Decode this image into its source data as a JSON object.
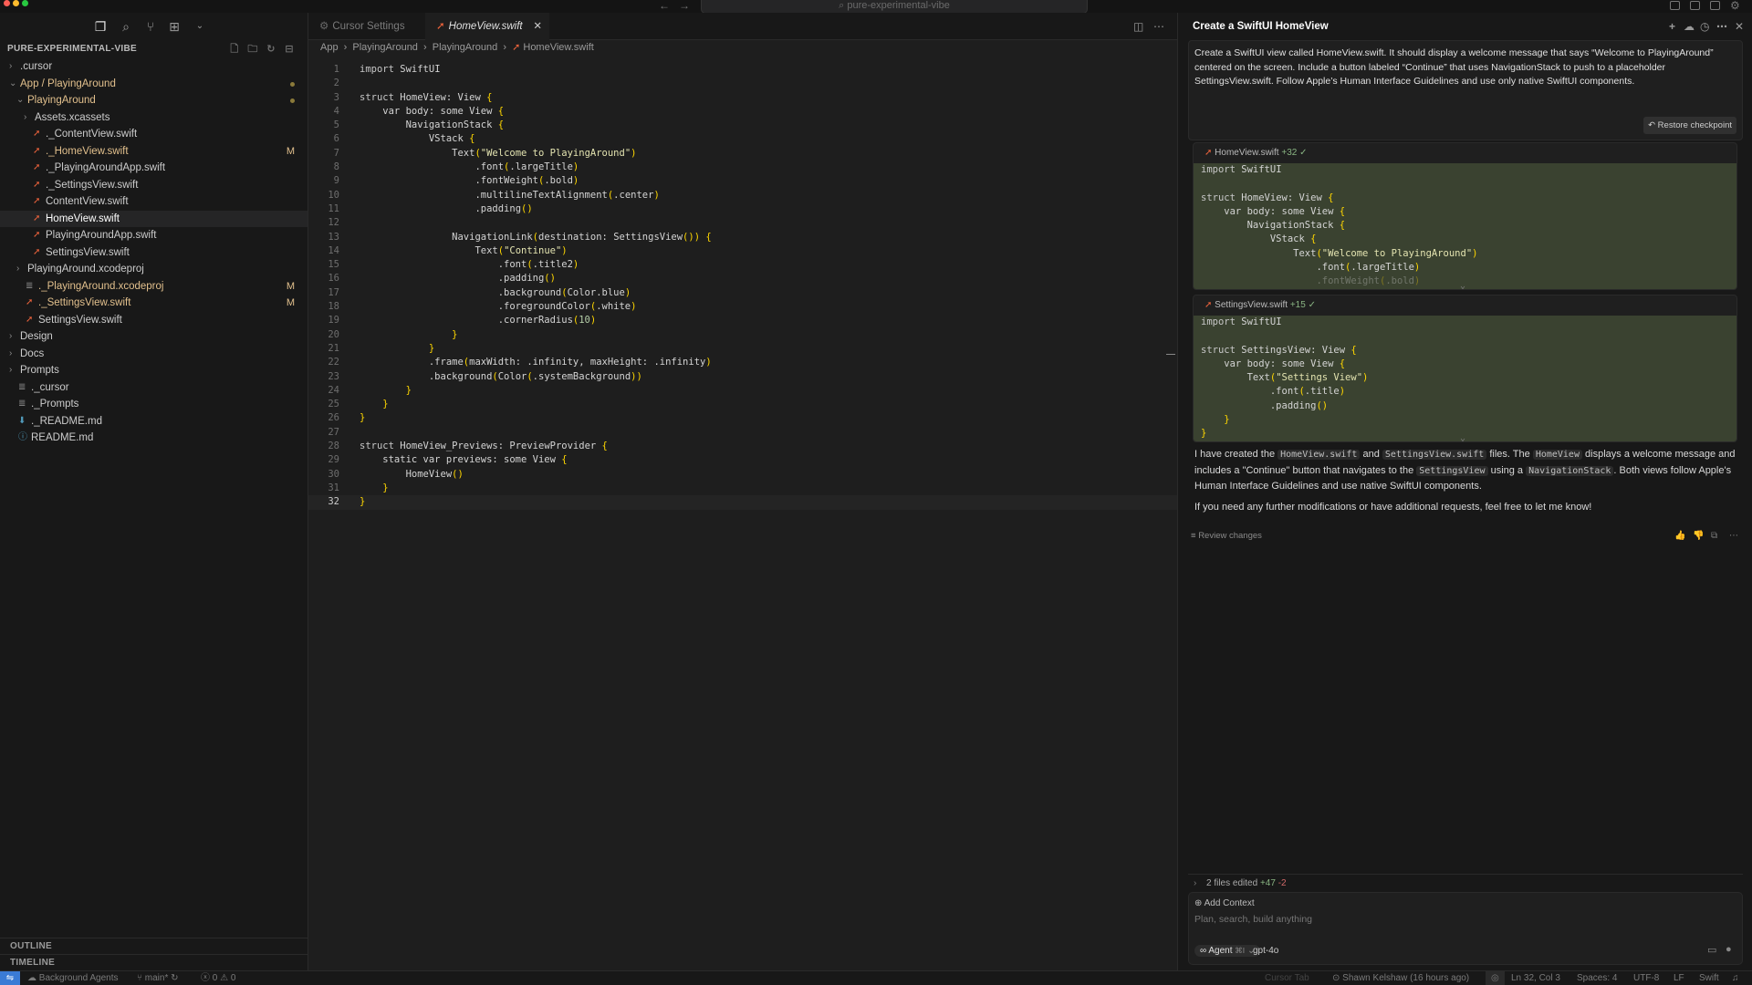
{
  "titlebar": {
    "search_text": "⌕ pure-experimental-vibe",
    "back_arrow": "←",
    "forward_arrow": "→"
  },
  "sidebar": {
    "section_title": "PURE-EXPERIMENTAL-VIBE",
    "tree": [
      {
        "label": ".cursor",
        "indent": 0,
        "kind": "folder",
        "expanded": false
      },
      {
        "label": "App / PlayingAround",
        "indent": 0,
        "kind": "folder",
        "expanded": true,
        "modified_dot": true,
        "color": "yellow"
      },
      {
        "label": "PlayingAround",
        "indent": 1,
        "kind": "folder",
        "expanded": true,
        "modified_dot": true,
        "color": "yellow"
      },
      {
        "label": "Assets.xcassets",
        "indent": 2,
        "kind": "folder",
        "expanded": false
      },
      {
        "label": "._ContentView.swift",
        "indent": 2,
        "kind": "swift"
      },
      {
        "label": "._HomeView.swift",
        "indent": 2,
        "kind": "swift",
        "badge": "M",
        "color": "yellow"
      },
      {
        "label": "._PlayingAroundApp.swift",
        "indent": 2,
        "kind": "swift"
      },
      {
        "label": "._SettingsView.swift",
        "indent": 2,
        "kind": "swift"
      },
      {
        "label": "ContentView.swift",
        "indent": 2,
        "kind": "swift"
      },
      {
        "label": "HomeView.swift",
        "indent": 2,
        "kind": "swift",
        "selected": true
      },
      {
        "label": "PlayingAroundApp.swift",
        "indent": 2,
        "kind": "swift"
      },
      {
        "label": "SettingsView.swift",
        "indent": 2,
        "kind": "swift"
      },
      {
        "label": "PlayingAround.xcodeproj",
        "indent": 1,
        "kind": "folder",
        "expanded": false
      },
      {
        "label": "._PlayingAround.xcodeproj",
        "indent": 1,
        "kind": "file",
        "badge": "M",
        "color": "yellow"
      },
      {
        "label": "._SettingsView.swift",
        "indent": 1,
        "kind": "swift",
        "badge": "M",
        "color": "yellow"
      },
      {
        "label": "SettingsView.swift",
        "indent": 1,
        "kind": "swift"
      },
      {
        "label": "Design",
        "indent": 0,
        "kind": "folder",
        "expanded": false
      },
      {
        "label": "Docs",
        "indent": 0,
        "kind": "folder",
        "expanded": false
      },
      {
        "label": "Prompts",
        "indent": 0,
        "kind": "folder",
        "expanded": false
      },
      {
        "label": "._cursor",
        "indent": 0,
        "kind": "file"
      },
      {
        "label": "._Prompts",
        "indent": 0,
        "kind": "file"
      },
      {
        "label": "._README.md",
        "indent": 0,
        "kind": "md-down"
      },
      {
        "label": "README.md",
        "indent": 0,
        "kind": "md-info"
      }
    ],
    "outline_label": "OUTLINE",
    "timeline_label": "TIMELINE"
  },
  "editor": {
    "tabs": [
      {
        "label": "Cursor Settings",
        "active": false
      },
      {
        "label": "HomeView.swift",
        "active": true
      }
    ],
    "breadcrumb": [
      "App",
      "PlayingAround",
      "PlayingAround",
      "HomeView.swift"
    ],
    "current_line": 32,
    "code": [
      "import SwiftUI",
      "",
      "struct HomeView: View {",
      "    var body: some View {",
      "        NavigationStack {",
      "            VStack {",
      "                Text(\"Welcome to PlayingAround\")",
      "                    .font(.largeTitle)",
      "                    .fontWeight(.bold)",
      "                    .multilineTextAlignment(.center)",
      "                    .padding()",
      "",
      "                NavigationLink(destination: SettingsView()) {",
      "                    Text(\"Continue\")",
      "                        .font(.title2)",
      "                        .padding()",
      "                        .background(Color.blue)",
      "                        .foregroundColor(.white)",
      "                        .cornerRadius(10)",
      "                }",
      "            }",
      "            .frame(maxWidth: .infinity, maxHeight: .infinity)",
      "            .background(Color(.systemBackground))",
      "        }",
      "    }",
      "}",
      "",
      "struct HomeView_Previews: PreviewProvider {",
      "    static var previews: some View {",
      "        HomeView()",
      "    }",
      "}"
    ]
  },
  "chat": {
    "title": "Create a SwiftUI HomeView",
    "user_message": "Create a SwiftUI view called HomeView.swift. It should display a welcome message that says “Welcome to PlayingAround” centered on the screen. Include a button labeled “Continue” that uses NavigationStack to push to a placeholder SettingsView.swift. Follow Apple’s Human Interface Guidelines and use only native SwiftUI components.",
    "restore_label": "Restore checkpoint",
    "diffs": [
      {
        "file": "HomeView.swift",
        "additions": "+32",
        "lines": [
          "import SwiftUI",
          "",
          "struct HomeView: View {",
          "    var body: some View {",
          "        NavigationStack {",
          "            VStack {",
          "                Text(\"Welcome to PlayingAround\")",
          "                    .font(.largeTitle)",
          "                    .fontWeight(.bold)"
        ]
      },
      {
        "file": "SettingsView.swift",
        "additions": "+15",
        "lines": [
          "import SwiftUI",
          "",
          "struct SettingsView: View {",
          "    var body: some View {",
          "        Text(\"Settings View\")",
          "            .font(.title)",
          "            .padding()",
          "    }",
          "}"
        ]
      }
    ],
    "reply": {
      "p1_a": "I have created the ",
      "p1_code1": "HomeView.swift",
      "p1_b": " and ",
      "p1_code2": "SettingsView.swift",
      "p1_c": " files. The ",
      "p1_code3": "HomeView",
      "p1_d": " displays a welcome message and includes a \"Continue\" button that navigates to the ",
      "p1_code4": "SettingsView",
      "p1_e": " using a ",
      "p1_code5": "NavigationStack",
      "p1_f": ". Both views follow Apple's Human Interface Guidelines and use native SwiftUI components.",
      "p2": "If you need any further modifications or have additional requests, feel free to let me know!"
    },
    "review_label": "Review changes",
    "files_edited": {
      "label": "2 files edited",
      "plus": "+47",
      "minus": "-2"
    },
    "composer": {
      "add_context": "Add Context",
      "placeholder": "Plan, search, build anything",
      "mode": "Agent",
      "mode_shortcut": "⌘I",
      "model": "gpt-4o"
    }
  },
  "statusbar": {
    "background_agents": "Background Agents",
    "branch": "main*",
    "errors": "0",
    "warnings": "0",
    "cursor_tab": "Cursor Tab",
    "blame": "Shawn Kelshaw (16 hours ago)",
    "position": "Ln 32, Col 3",
    "spaces": "Spaces: 4",
    "encoding": "UTF-8",
    "eol": "LF",
    "language": "Swift"
  },
  "colors": {
    "accent": "#3a7bd5",
    "modified": "#e2c08d",
    "diff_bg": "#3a4230",
    "swift": "#f0643c"
  }
}
